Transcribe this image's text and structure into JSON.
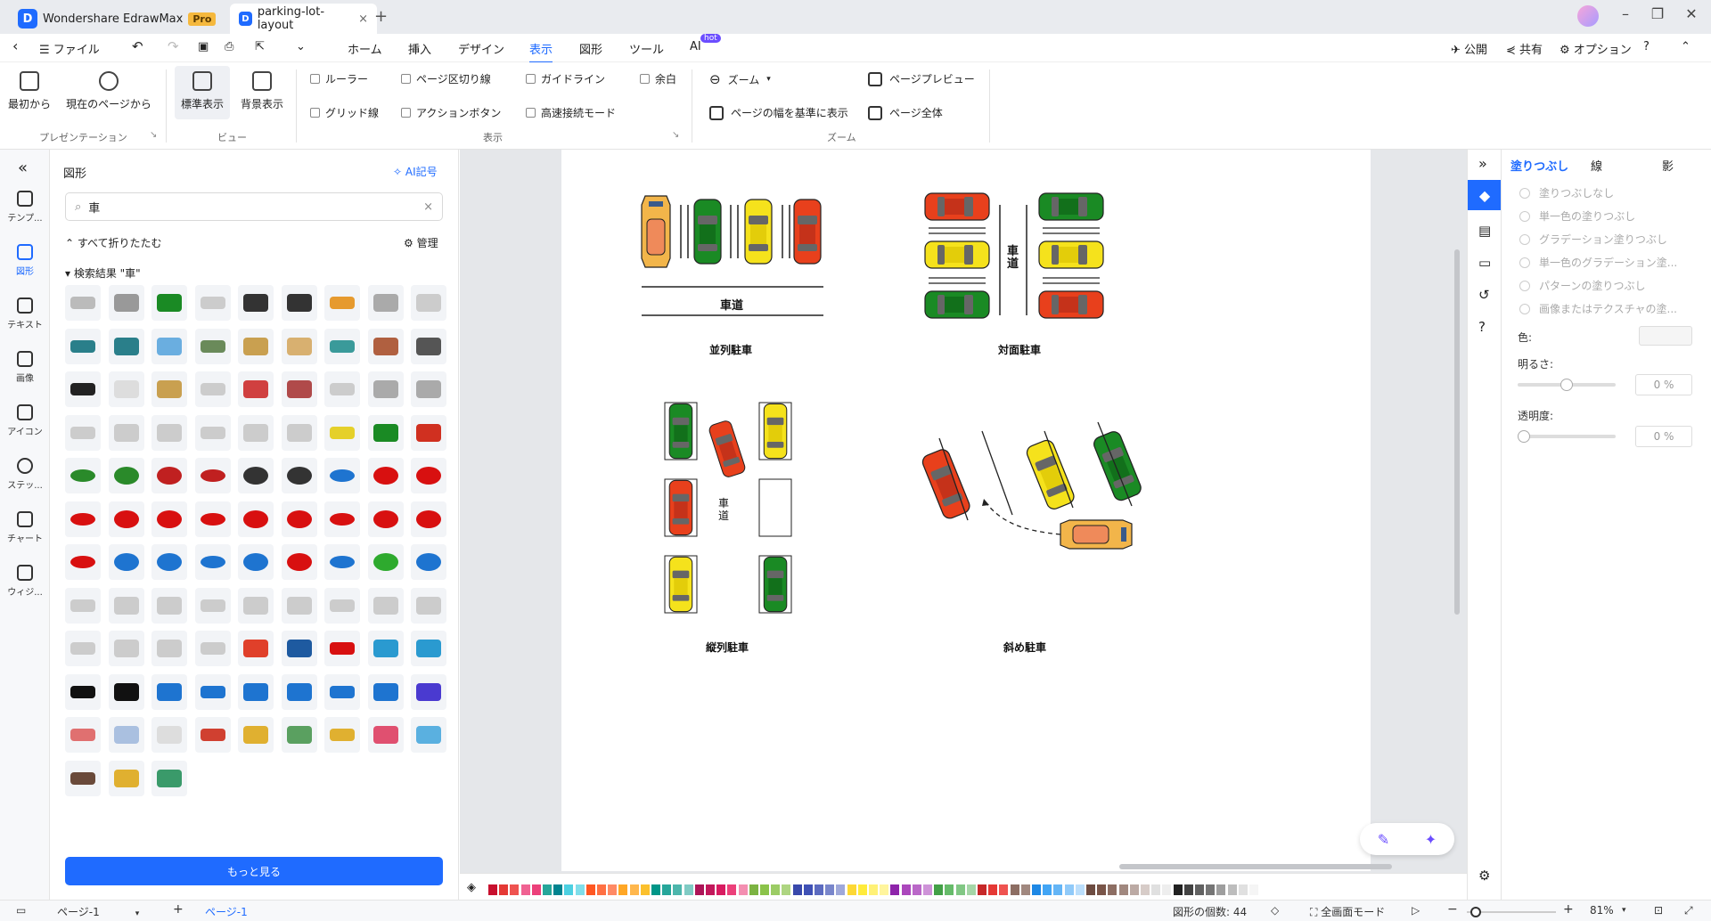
{
  "app": {
    "name": "Wondershare EdrawMax",
    "badge": "Pro",
    "doc_tab": "parking-lot-layout"
  },
  "menu": {
    "file": "ファイル",
    "items": [
      "ホーム",
      "挿入",
      "デザイン",
      "表示",
      "図形",
      "ツール",
      "AI"
    ],
    "active": "表示",
    "hot": "hot",
    "publish": "公開",
    "share": "共有",
    "options": "オプション"
  },
  "ribbon": {
    "presentation": {
      "from_start": "最初から",
      "from_current": "現在のページから",
      "group": "プレゼンテーション"
    },
    "view": {
      "normal": "標準表示",
      "background": "背景表示",
      "group": "ビュー"
    },
    "show": {
      "ruler": "ルーラー",
      "page_break": "ページ区切り線",
      "guideline": "ガイドライン",
      "margin": "余白",
      "grid": "グリッド線",
      "action_button": "アクションボタン",
      "fast_connect": "高速接続モード",
      "group": "表示"
    },
    "zoom": {
      "zoom": "ズーム",
      "fit_width": "ページの幅を基準に表示",
      "page_preview": "ページプレビュー",
      "whole_page": "ページ全体",
      "group": "ズーム"
    }
  },
  "leftnav": {
    "items": [
      "テンプ...",
      "図形",
      "テキスト",
      "画像",
      "アイコン",
      "ステッ...",
      "チャート",
      "ウィジ..."
    ],
    "active": "図形"
  },
  "shapes_panel": {
    "title": "図形",
    "ai_symbol": "AI記号",
    "search_value": "車",
    "collapse_all": "すべて折りたたむ",
    "manage": "管理",
    "results_label": "検索結果 \"車\"",
    "more": "もっと見る"
  },
  "canvas": {
    "road": "車道",
    "road_vertical": "車道",
    "captions": {
      "parallel": "並列駐車",
      "facing": "対面駐車",
      "tandem": "縦列駐車",
      "angled": "斜め駐車"
    }
  },
  "right_panel": {
    "tabs": [
      "塗りつぶし",
      "線",
      "影"
    ],
    "active_tab": "塗りつぶし",
    "fill_options": [
      "塗りつぶしなし",
      "単一色の塗りつぶし",
      "グラデーション塗りつぶし",
      "単一色のグラデーション塗...",
      "パターンの塗りつぶし",
      "画像またはテクスチャの塗..."
    ],
    "color_label": "色:",
    "brightness_label": "明るさ:",
    "brightness_value": "0 %",
    "transparency_label": "透明度:",
    "transparency_value": "0 %"
  },
  "statusbar": {
    "page_selector": "ページ-1",
    "page_tab": "ページ-1",
    "shape_count_label": "図形の個数:",
    "shape_count": "44",
    "fullscreen": "全画面モード",
    "zoom": "81%"
  },
  "palette": [
    "#c8102e",
    "#e53935",
    "#ef5350",
    "#f06292",
    "#ec407a",
    "#26a69a",
    "#00838f",
    "#4dd0e1",
    "#80deea",
    "#ff5722",
    "#ff7043",
    "#ff8a65",
    "#ffa726",
    "#ffb74d",
    "#fbc02d",
    "#009688",
    "#26a69a",
    "#4db6ac",
    "#80cbc4",
    "#ad1457",
    "#c2185b",
    "#d81b60",
    "#ec407a",
    "#f48fb1",
    "#7cb342",
    "#8bc34a",
    "#9ccc65",
    "#aed581",
    "#3949ab",
    "#3f51b5",
    "#5c6bc0",
    "#7986cb",
    "#9fa8da",
    "#fdd835",
    "#ffeb3b",
    "#fff176",
    "#fff59d",
    "#8e24aa",
    "#ab47bc",
    "#ba68c8",
    "#ce93d8",
    "#43a047",
    "#66bb6a",
    "#81c784",
    "#a5d6a7",
    "#c62828",
    "#e53935",
    "#ef5350",
    "#8d6e63",
    "#a1887f",
    "#1e88e5",
    "#42a5f5",
    "#64b5f6",
    "#90caf9",
    "#bbdefb",
    "#6d4c41",
    "#795548",
    "#8d6e63",
    "#a1887f",
    "#bcaaa4",
    "#d7ccc8",
    "#e0e0e0",
    "#eeeeee",
    "#212121",
    "#424242",
    "#616161",
    "#757575",
    "#9e9e9e",
    "#bdbdbd",
    "#e0e0e0",
    "#f5f5f5"
  ]
}
